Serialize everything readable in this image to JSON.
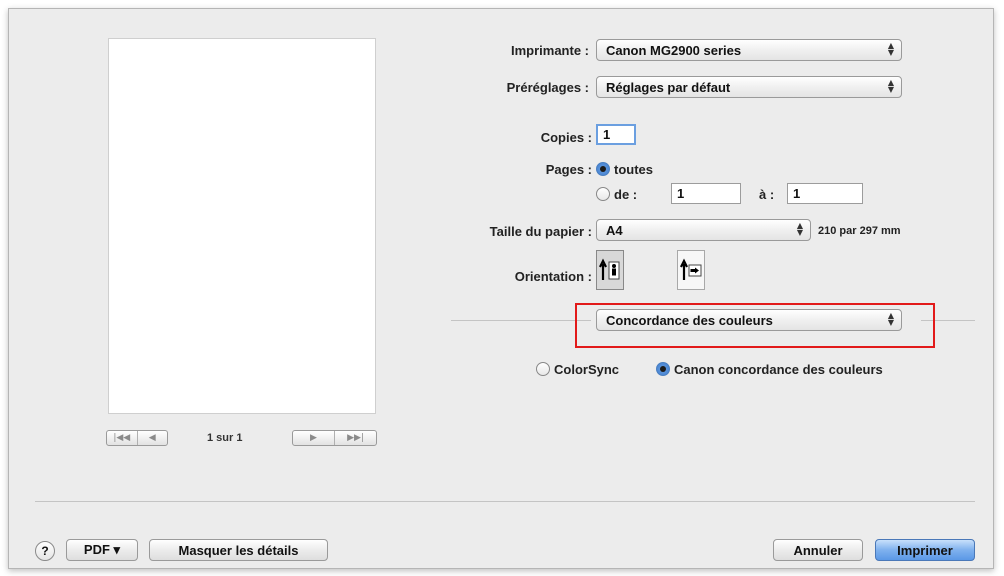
{
  "printer": {
    "label": "Imprimante :",
    "value": "Canon MG2900 series"
  },
  "presets": {
    "label": "Préréglages :",
    "value": "Réglages par défaut"
  },
  "copies": {
    "label": "Copies :",
    "value": "1"
  },
  "pages": {
    "label": "Pages :",
    "all_label": "toutes",
    "from_label": "de :",
    "from_value": "1",
    "to_label": "à :",
    "to_value": "1",
    "selected": "toutes"
  },
  "paper_size": {
    "label": "Taille du papier :",
    "value": "A4",
    "dimensions": "210 par 297 mm"
  },
  "orientation": {
    "label": "Orientation :",
    "selected": "portrait"
  },
  "panel_select": {
    "value": "Concordance des couleurs"
  },
  "color_matching": {
    "colorsync_label": "ColorSync",
    "canon_label": "Canon concordance des couleurs",
    "selected": "Canon concordance des couleurs"
  },
  "preview": {
    "page_indicator": "1 sur 1",
    "first_icon": "|◀◀",
    "prev_icon": "◀",
    "next_icon": "▶",
    "last_icon": "▶▶|"
  },
  "footer": {
    "help_label": "?",
    "pdf_label": "PDF ▾",
    "hide_details_label": "Masquer les détails",
    "cancel_label": "Annuler",
    "print_label": "Imprimer"
  },
  "colors": {
    "highlight": "#e21a1a",
    "accent": "#5b98e6"
  },
  "icons": [
    "help-icon",
    "stepper-arrows-icon",
    "portrait-icon",
    "landscape-icon",
    "first-page-icon",
    "previous-page-icon",
    "next-page-icon",
    "last-page-icon"
  ]
}
